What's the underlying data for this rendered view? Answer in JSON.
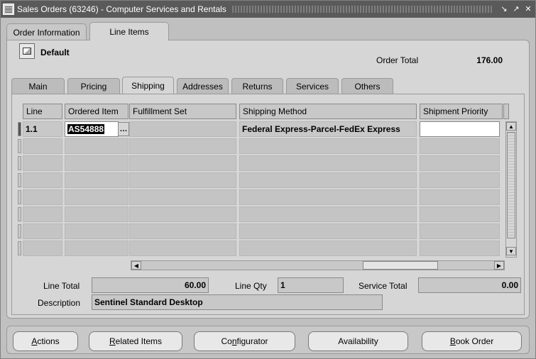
{
  "window": {
    "title": "Sales Orders (63246) - Computer Services and Rentals",
    "controls": [
      "minimize-icon",
      "maximize-icon",
      "close-icon"
    ]
  },
  "top_tabs": [
    {
      "label": "Order Information",
      "active": false
    },
    {
      "label": "Line Items",
      "active": true
    }
  ],
  "header": {
    "default_label": "Default",
    "order_total_label": "Order Total",
    "order_total_value": "176.00"
  },
  "sub_tabs": [
    {
      "label": "Main"
    },
    {
      "label": "Pricing"
    },
    {
      "label": "Shipping",
      "active": true
    },
    {
      "label": "Addresses"
    },
    {
      "label": "Returns"
    },
    {
      "label": "Services"
    },
    {
      "label": "Others"
    }
  ],
  "grid": {
    "columns": [
      "Line",
      "Ordered Item",
      "Fulfillment Set",
      "Shipping Method",
      "Shipment Priority"
    ],
    "rows": [
      {
        "line": "1.1",
        "ordered_item": "AS54888",
        "fulfillment_set": "",
        "shipping_method": "Federal Express-Parcel-FedEx Express",
        "shipment_priority": ""
      }
    ],
    "empty_rows": 7
  },
  "summary": {
    "line_total_label": "Line Total",
    "line_total_value": "60.00",
    "line_qty_label": "Line Qty",
    "line_qty_value": "1",
    "service_total_label": "Service Total",
    "service_total_value": "0.00",
    "description_label": "Description",
    "description_value": "Sentinel Standard Desktop"
  },
  "buttons": {
    "actions": {
      "mnemonic": "A",
      "rest": "ctions"
    },
    "related_items": {
      "mnemonic": "R",
      "rest": "elated Items"
    },
    "configurator": {
      "pre": "Co",
      "mnemonic": "n",
      "rest": "figurator"
    },
    "availability": {
      "label": "Availability"
    },
    "book_order": {
      "mnemonic": "B",
      "rest": "ook Order"
    }
  }
}
